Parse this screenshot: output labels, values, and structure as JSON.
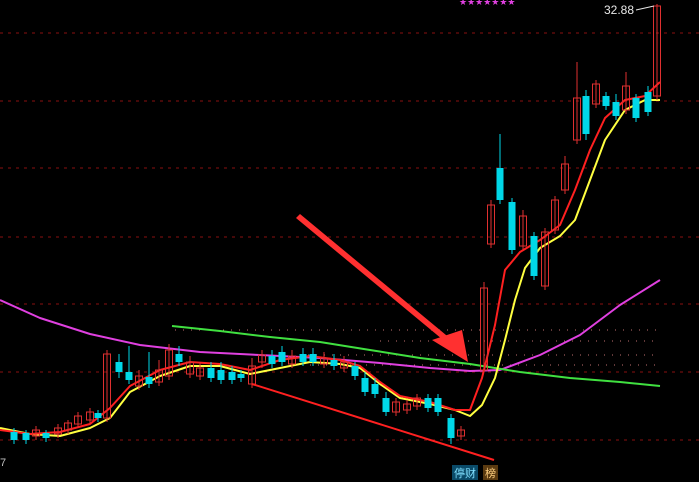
{
  "chart_data": {
    "type": "candlestick",
    "price_label": "32.88",
    "axis_edge_label": "7",
    "star_marks": "★★★★★★★",
    "badges": [
      {
        "text": "停财",
        "color": "#1aa0c8"
      },
      {
        "text": "榜",
        "color": "#c8a040"
      }
    ],
    "colors": {
      "up": "#e03030",
      "down": "#00d8e8",
      "ma_fast": "#ff2020",
      "ma_slow": "#ffff40",
      "ma_long": "#e040e0",
      "ma_green": "#40e040",
      "trend_line": "#ff2020",
      "arrow": "#ff3030",
      "grid": "#8a1010",
      "dots": "#c07070",
      "stars": "#e040e0"
    }
  }
}
